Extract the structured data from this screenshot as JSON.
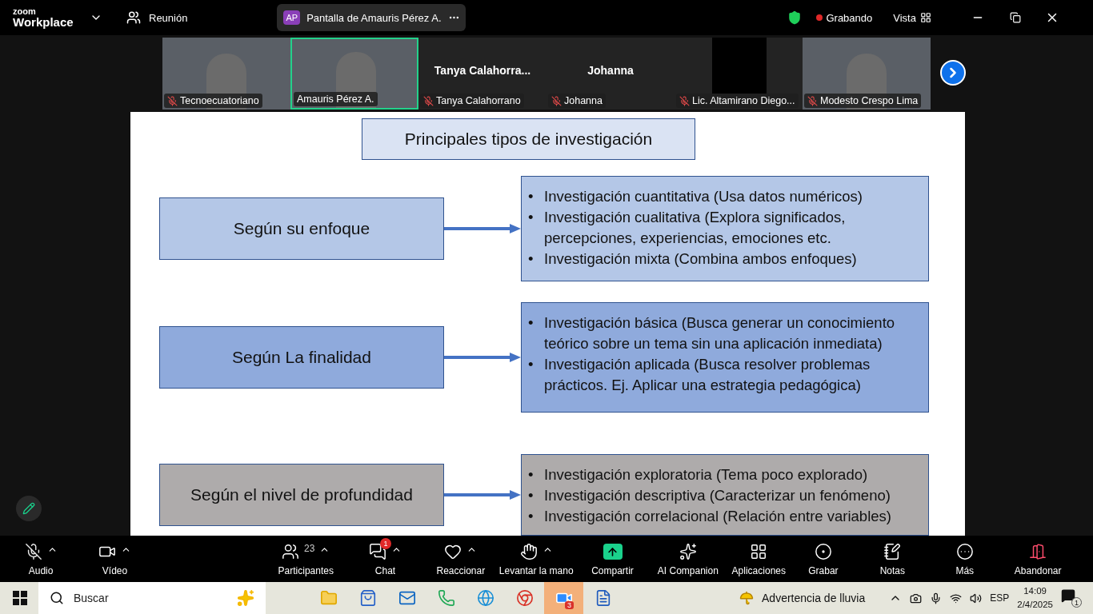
{
  "topbar": {
    "brand_small": "zoom",
    "brand": "Workplace",
    "meeting": "Reunión",
    "share": {
      "initials": "AP",
      "text": "Pantalla de Amauris Pérez A."
    },
    "recording": "Grabando",
    "view": "Vista"
  },
  "participants": [
    {
      "kind": "video",
      "name": "Tecnoecuatoriano",
      "muted": true,
      "speaking": false
    },
    {
      "kind": "video",
      "name": "Amauris Pérez A.",
      "muted": false,
      "speaking": true
    },
    {
      "kind": "name",
      "title": "Tanya  Calahorra...",
      "name": "Tanya Calahorrano",
      "muted": true,
      "speaking": false
    },
    {
      "kind": "name",
      "title": "Johanna",
      "name": "Johanna",
      "muted": true,
      "speaking": false
    },
    {
      "kind": "blank",
      "name": "Lic. Altamirano Diego...",
      "muted": true,
      "speaking": false
    },
    {
      "kind": "video",
      "name": "Modesto Crespo Lima",
      "muted": true,
      "speaking": false
    }
  ],
  "slide": {
    "title": "Principales tipos de investigación",
    "rows": [
      {
        "label": "Según su enfoque",
        "color": "#b4c7e7",
        "bullets": [
          {
            "marker": "•",
            "text": "Investigación cuantitativa (Usa datos numéricos)"
          },
          {
            "marker": "•",
            "text": "Investigación cualitativa (Explora significados, percepciones, experiencias, emociones etc."
          },
          {
            "marker": "•",
            "text": "Investigación mixta (Combina ambos enfoques)"
          }
        ]
      },
      {
        "label": "Según La finalidad",
        "color": "#8faadc",
        "bullets": [
          {
            "marker": "•",
            "text": "Investigación básica (Busca generar un conocimiento teórico sobre un tema sin una aplicación inmediata)"
          },
          {
            "marker": "•",
            "text": "Investigación aplicada (Busca resolver problemas prácticos. Ej. Aplicar una estrategia pedagógica)"
          }
        ]
      },
      {
        "label": "Según el nivel de profundidad",
        "color": "#aeabab",
        "bullets": [
          {
            "marker": "•",
            "text": "Investigación exploratoria (Tema poco explorado)"
          },
          {
            "marker": "•",
            "text": "Investigación descriptiva (Caracterizar un fenómeno)"
          },
          {
            "marker": "•",
            "text": "Investigación correlacional (Relación entre variables)"
          }
        ]
      }
    ]
  },
  "toolbar": [
    {
      "kind": "audio",
      "label": "Audio",
      "muted": true,
      "caret": true
    },
    {
      "kind": "video",
      "label": "Vídeo",
      "caret": true
    },
    {
      "kind": "participants",
      "label": "Participantes",
      "count": "23",
      "caret": true
    },
    {
      "kind": "chat",
      "label": "Chat",
      "badge": "1",
      "caret": true
    },
    {
      "kind": "react",
      "label": "Reaccionar",
      "caret": true
    },
    {
      "kind": "hand",
      "label": "Levantar la mano",
      "caret": true
    },
    {
      "kind": "share",
      "label": "Compartir",
      "caret": false
    },
    {
      "kind": "ai",
      "label": "AI Companion",
      "caret": false
    },
    {
      "kind": "apps",
      "label": "Aplicaciones",
      "caret": false
    },
    {
      "kind": "record",
      "label": "Grabar",
      "caret": false
    },
    {
      "kind": "notes",
      "label": "Notas",
      "caret": false
    },
    {
      "kind": "more",
      "label": "Más",
      "caret": false
    },
    {
      "kind": "leave",
      "label": "Abandonar",
      "caret": false
    }
  ],
  "taskbar": {
    "search_placeholder": "Buscar",
    "apps": [
      {
        "kind": "folder"
      },
      {
        "kind": "store"
      },
      {
        "kind": "mail"
      },
      {
        "kind": "whatsapp"
      },
      {
        "kind": "edge"
      },
      {
        "kind": "chrome"
      },
      {
        "kind": "zoom",
        "badge": "3"
      },
      {
        "kind": "word"
      }
    ],
    "weather": "Advertencia de lluvia",
    "language": "ESP",
    "time": "14:09",
    "date": "2/4/2025",
    "notifications": "1"
  }
}
